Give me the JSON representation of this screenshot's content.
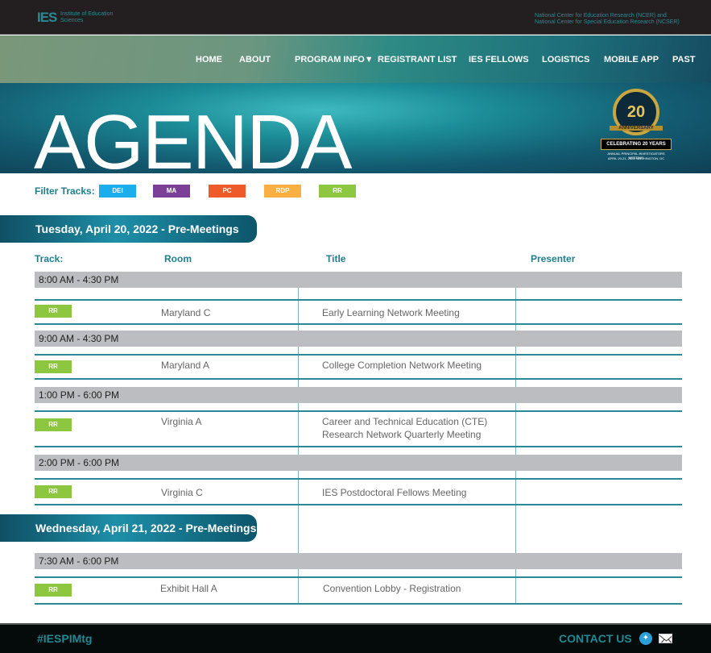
{
  "header": {
    "logo": "IES",
    "logo_sub": "Institute of Education Sciences",
    "centers": [
      "National Center for Education Research (NCER) and",
      "National Center for Special Education Research (NCSER)"
    ]
  },
  "nav": [
    "HOME",
    "ABOUT",
    "PROGRAM INFO▼",
    "REGISTRANT LIST",
    "IES FELLOWS",
    "LOGISTICS",
    "MOBILE APP",
    "PAST"
  ],
  "hero": {
    "title": "AGENDA",
    "badge": {
      "number": "20",
      "ribbon": "ANNIVERSARY",
      "headline": "CELEBRATING 20 YEARS",
      "event": "ANNUAL PRINCIPAL INVESTIGATORS MEETING",
      "date": "APRIL 20-21, 2022  WASHINGTON, DC"
    }
  },
  "filter": {
    "label": "Filter Tracks:",
    "tracks": [
      {
        "label": "DEI",
        "color": "#1badec"
      },
      {
        "label": "MA",
        "color": "#7b3f98"
      },
      {
        "label": "PC",
        "color": "#ef5a2b"
      },
      {
        "label": "RDP",
        "color": "#fbae42"
      },
      {
        "label": "RR",
        "color": "#8dc63f"
      }
    ]
  },
  "columns": {
    "track": "Track:",
    "room": "Room",
    "title": "Title",
    "presenter": "Presenter"
  },
  "days": [
    {
      "label": "Tuesday, April 20, 2022 - Pre-Meetings"
    },
    {
      "label": "Wednesday, April 21, 2022 - Pre-Meetings"
    }
  ],
  "sessions": [
    {
      "time": "8:00 AM - 4:30 PM",
      "track": "RR",
      "room": "Maryland C",
      "title": "Early Learning Network Meeting"
    },
    {
      "time": "9:00 AM - 4:30 PM",
      "track": "RR",
      "room": "Maryland A",
      "title": "College Completion Network Meeting"
    },
    {
      "time": "1:00 PM - 6:00 PM",
      "track": "RR",
      "room": "Virginia A",
      "title": "Career and Technical Education (CTE) Research Network Quarterly Meeting"
    },
    {
      "time": "2:00 PM - 6:00 PM",
      "track": "RR",
      "room": "Virginia C",
      "title": "IES Postdoctoral Fellows Meeting"
    },
    {
      "time": "7:30 AM - 6:00 PM",
      "track": "RR",
      "room": "Exhibit Hall A",
      "title": "Convention Lobby - Registration"
    }
  ],
  "footer": {
    "hashtag": "#IESPIMtg",
    "contact": "CONTACT US"
  },
  "icons": {
    "twitter": "twitter-icon",
    "email": "envelope-icon"
  }
}
